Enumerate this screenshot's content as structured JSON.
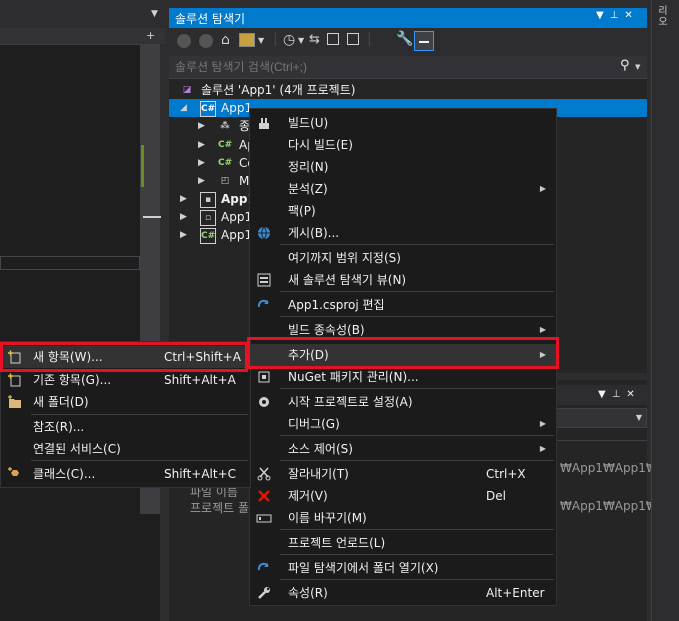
{
  "solution_explorer": {
    "title": "솔루션 탐색기",
    "search_placeholder": "솔루션 탐색기 검색(Ctrl+;)",
    "tree": {
      "solution": "솔루션 'App1' (4개 프로젝트)",
      "project_selected": "App1",
      "child1": "종",
      "child2": "Ap",
      "child3": "Co",
      "child4": "M",
      "project2": "App1",
      "project3": "App1",
      "project4": "App1"
    }
  },
  "right_strip": {
    "label": "리오"
  },
  "lower_panel": {
    "path1": "₩App1₩App1₩A",
    "path2": "₩App1₩App1₩",
    "label1": "파일 이름",
    "label2": "프로젝트 폴"
  },
  "context_menu": {
    "items": [
      {
        "label": "빌드(U)",
        "icon": "build-icon"
      },
      {
        "label": "다시 빌드(E)"
      },
      {
        "label": "정리(N)"
      },
      {
        "label": "분석(Z)",
        "submenu": true
      },
      {
        "label": "팩(P)"
      },
      {
        "label": "게시(B)...",
        "icon": "globe-icon"
      },
      {
        "label": "여기까지 범위 지정(S)"
      },
      {
        "label": "새 솔루션 탐색기 뷰(N)",
        "icon": "new-view-icon"
      },
      {
        "label": "App1.csproj 편집",
        "icon": "refresh-icon"
      },
      {
        "label": "빌드 종속성(B)",
        "submenu": true
      },
      {
        "label": "추가(D)",
        "submenu": true,
        "highlighted": true
      },
      {
        "label": "NuGet 패키지 관리(N)...",
        "icon": "nuget-icon"
      },
      {
        "label": "시작 프로젝트로 설정(A)",
        "icon": "gear-icon"
      },
      {
        "label": "디버그(G)",
        "submenu": true
      },
      {
        "label": "소스 제어(S)",
        "submenu": true
      },
      {
        "label": "잘라내기(T)",
        "shortcut": "Ctrl+X",
        "icon": "scissors-icon"
      },
      {
        "label": "제거(V)",
        "shortcut": "Del",
        "icon": "delete-x-icon"
      },
      {
        "label": "이름 바꾸기(M)",
        "icon": "rename-icon"
      },
      {
        "label": "프로젝트 언로드(L)"
      },
      {
        "label": "파일 탐색기에서 폴더 열기(X)",
        "icon": "refresh-icon"
      },
      {
        "label": "속성(R)",
        "shortcut": "Alt+Enter",
        "icon": "wrench-icon"
      }
    ]
  },
  "add_submenu": {
    "items": [
      {
        "label": "새 항목(W)...",
        "shortcut": "Ctrl+Shift+A",
        "icon": "new-item-icon",
        "highlighted": true
      },
      {
        "label": "기존 항목(G)...",
        "shortcut": "Shift+Alt+A",
        "icon": "existing-item-icon"
      },
      {
        "label": "새 폴더(D)",
        "icon": "new-folder-icon"
      },
      {
        "label": "참조(R)..."
      },
      {
        "label": "연결된 서비스(C)"
      },
      {
        "label": "클래스(C)...",
        "shortcut": "Shift+Alt+C",
        "icon": "class-icon"
      }
    ]
  },
  "colors": {
    "accent": "#007acc",
    "highlight_box": "#e81123",
    "menu_bg": "#1b1b1c",
    "panel_bg": "#252526"
  }
}
